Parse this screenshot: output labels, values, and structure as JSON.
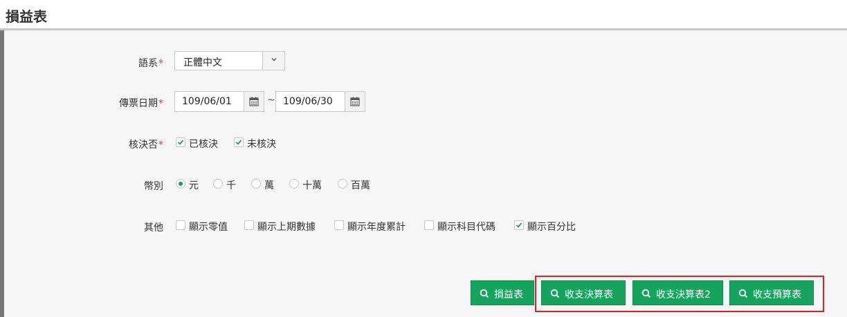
{
  "page": {
    "title": "損益表"
  },
  "form": {
    "language": {
      "label": "語系",
      "required_mark": "*",
      "value": "正體中文"
    },
    "voucher_date": {
      "label": "傳票日期",
      "required_mark": "*",
      "from": "109/06/01",
      "to": "109/06/30",
      "separator": "~"
    },
    "approval": {
      "label": "核決否",
      "required_mark": "*",
      "options": [
        {
          "label": "已核決",
          "checked": true
        },
        {
          "label": "未核決",
          "checked": true
        }
      ]
    },
    "currency_unit": {
      "label": "幣別",
      "options": [
        {
          "label": "元",
          "selected": true
        },
        {
          "label": "千",
          "selected": false
        },
        {
          "label": "萬",
          "selected": false
        },
        {
          "label": "十萬",
          "selected": false
        },
        {
          "label": "百萬",
          "selected": false
        }
      ]
    },
    "other": {
      "label": "其他",
      "options": [
        {
          "label": "顯示零值",
          "checked": false
        },
        {
          "label": "顯示上期數據",
          "checked": false
        },
        {
          "label": "顯示年度累計",
          "checked": false
        },
        {
          "label": "顯示科目代碼",
          "checked": false
        },
        {
          "label": "顯示百分比",
          "checked": true
        }
      ]
    }
  },
  "actions": {
    "buttons": [
      {
        "label": "損益表",
        "icon": "search-icon"
      },
      {
        "label": "收支決算表",
        "icon": "search-icon"
      },
      {
        "label": "收支決算表2",
        "icon": "search-icon"
      },
      {
        "label": "收支預算表",
        "icon": "search-icon"
      }
    ]
  },
  "colors": {
    "primary_button": "#14a45d",
    "required": "#e0403a",
    "highlight_border": "#e02020",
    "check": "#17a063"
  }
}
